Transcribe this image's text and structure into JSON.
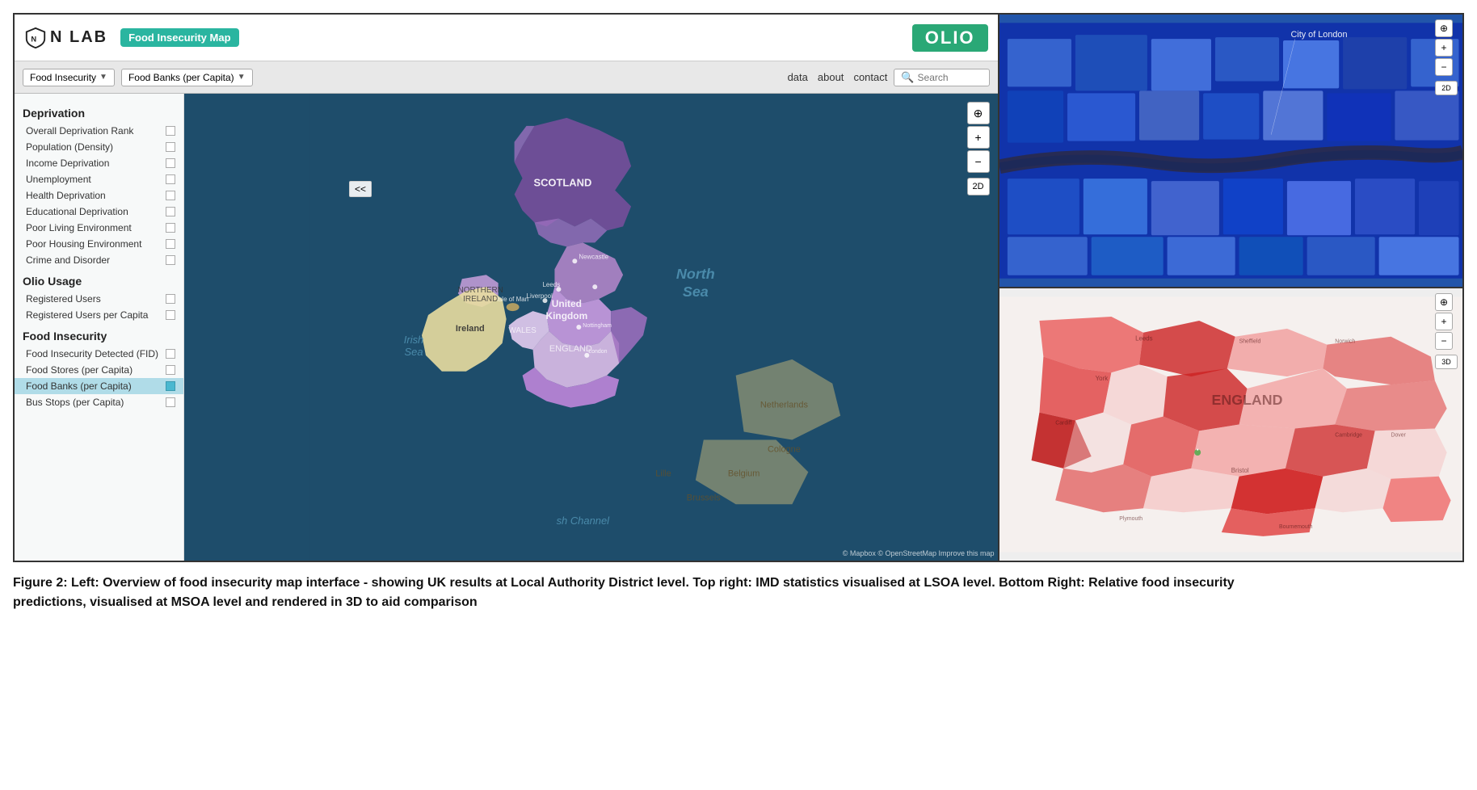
{
  "header": {
    "nlab_text": "N LAB",
    "food_insecurity_badge": "Food Insecurity Map",
    "olio_badge": "OLIO"
  },
  "toolbar": {
    "food_insecurity_dropdown": "Food Insecurity",
    "food_banks_dropdown": "Food Banks (per Capita)",
    "nav_data": "data",
    "nav_about": "about",
    "nav_contact": "contact",
    "search_placeholder": "Search",
    "collapse_btn": "<<"
  },
  "sidebar": {
    "deprivation_title": "Deprivation",
    "deprivation_items": [
      "Overall Deprivation Rank",
      "Population (Density)",
      "Income Deprivation",
      "Unemployment",
      "Health Deprivation",
      "Educational Deprivation",
      "Poor Living Environment",
      "Poor Housing Environment",
      "Crime and Disorder"
    ],
    "olio_usage_title": "Olio Usage",
    "olio_usage_items": [
      "Registered Users",
      "Registered Users per Capita"
    ],
    "food_insecurity_title": "Food Insecurity",
    "food_insecurity_items": [
      "Food Insecurity Detected (FID)",
      "Food Stores (per Capita)",
      "Food Banks (per Capita)",
      "Bus Stops (per Capita)"
    ],
    "active_item": "Food Banks (per Capita)"
  },
  "map": {
    "north_sea_label": "North Sea",
    "channel_label": "sh Channel",
    "attribution": "© Mapbox © OpenStreetMap Improve this map",
    "controls": {
      "locate": "⊕",
      "zoom_in": "+",
      "zoom_out": "−",
      "toggle_2d": "2D"
    }
  },
  "right_maps": {
    "top": {
      "city_label": "City of London",
      "controls": {
        "locate": "⊕",
        "zoom_in": "+",
        "zoom_out": "−",
        "toggle_2d": "2D"
      }
    },
    "bottom": {
      "england_label": "ENGLAND",
      "controls": {
        "locate": "⊕",
        "zoom_in": "+",
        "zoom_out": "−",
        "toggle_3d": "3D"
      }
    }
  },
  "caption": {
    "text": "Figure 2: Left: Overview of food insecurity map interface - showing UK results at Local Authority District level. Top right: IMD statistics visualised at LSOA level. Bottom Right: Relative food insecurity predictions, visualised at MSOA level and rendered in 3D to aid comparison"
  }
}
